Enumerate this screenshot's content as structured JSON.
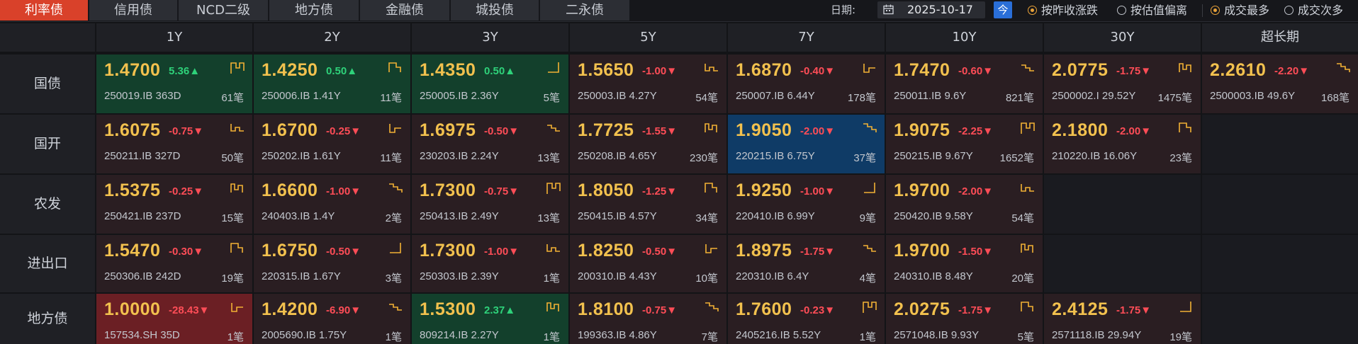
{
  "tabs": [
    {
      "label": "利率债",
      "active": true
    },
    {
      "label": "信用债",
      "active": false
    },
    {
      "label": "NCD二级",
      "active": false
    },
    {
      "label": "地方债",
      "active": false
    },
    {
      "label": "金融债",
      "active": false
    },
    {
      "label": "城投债",
      "active": false
    },
    {
      "label": "二永债",
      "active": false
    }
  ],
  "toolbar": {
    "date_label": "日期:",
    "date_value": "2025-10-17",
    "today_label": "今",
    "sort_options": [
      {
        "label": "按昨收涨跌",
        "selected": true
      },
      {
        "label": "按估值偏离",
        "selected": false
      }
    ],
    "volume_options": [
      {
        "label": "成交最多",
        "selected": true
      },
      {
        "label": "成交次多",
        "selected": false
      }
    ]
  },
  "columns": [
    "1Y",
    "2Y",
    "3Y",
    "5Y",
    "7Y",
    "10Y",
    "30Y",
    "超长期"
  ],
  "rows": [
    {
      "label": "国债",
      "cells": [
        {
          "yield": "1.4700",
          "change": "5.36▲",
          "dir": "pos",
          "code": "250019.IB 363D",
          "count": "61笔",
          "tone": "up",
          "icon": "trend-sparkline-icon"
        },
        {
          "yield": "1.4250",
          "change": "0.50▲",
          "dir": "pos",
          "code": "250006.IB 1.41Y",
          "count": "11笔",
          "tone": "up",
          "icon": "trend-sparkline-icon"
        },
        {
          "yield": "1.4350",
          "change": "0.50▲",
          "dir": "pos",
          "code": "250005.IB 2.36Y",
          "count": "5笔",
          "tone": "up",
          "icon": "trend-sparkline-icon"
        },
        {
          "yield": "1.5650",
          "change": "-1.00▼",
          "dir": "neg",
          "code": "250003.IB 4.27Y",
          "count": "54笔",
          "tone": "dn",
          "icon": "trend-sparkline-icon"
        },
        {
          "yield": "1.6870",
          "change": "-0.40▼",
          "dir": "neg",
          "code": "250007.IB 6.44Y",
          "count": "178笔",
          "tone": "dn",
          "icon": "trend-sparkline-icon"
        },
        {
          "yield": "1.7470",
          "change": "-0.60▼",
          "dir": "neg",
          "code": "250011.IB 9.6Y",
          "count": "821笔",
          "tone": "dn",
          "icon": "trend-sparkline-icon"
        },
        {
          "yield": "2.0775",
          "change": "-1.75▼",
          "dir": "neg",
          "code": "2500002.I 29.52Y",
          "count": "1475笔",
          "tone": "dn",
          "icon": "trend-sparkline-icon"
        },
        {
          "yield": "2.2610",
          "change": "-2.20▼",
          "dir": "neg",
          "code": "2500003.IB 49.6Y",
          "count": "168笔",
          "tone": "dn",
          "icon": "trend-sparkline-icon"
        }
      ]
    },
    {
      "label": "国开",
      "cells": [
        {
          "yield": "1.6075",
          "change": "-0.75▼",
          "dir": "neg",
          "code": "250211.IB 327D",
          "count": "50笔",
          "tone": "dn",
          "icon": "trend-sparkline-icon"
        },
        {
          "yield": "1.6700",
          "change": "-0.25▼",
          "dir": "neg",
          "code": "250202.IB 1.61Y",
          "count": "11笔",
          "tone": "dn",
          "icon": "trend-sparkline-icon"
        },
        {
          "yield": "1.6975",
          "change": "-0.50▼",
          "dir": "neg",
          "code": "230203.IB 2.24Y",
          "count": "13笔",
          "tone": "dn",
          "icon": "trend-sparkline-icon"
        },
        {
          "yield": "1.7725",
          "change": "-1.55▼",
          "dir": "neg",
          "code": "250208.IB 4.65Y",
          "count": "230笔",
          "tone": "dn",
          "icon": "trend-sparkline-icon"
        },
        {
          "yield": "1.9050",
          "change": "-2.00▼",
          "dir": "neg",
          "code": "220215.IB 6.75Y",
          "count": "37笔",
          "tone": "blue",
          "icon": "trend-sparkline-icon"
        },
        {
          "yield": "1.9075",
          "change": "-2.25▼",
          "dir": "neg",
          "code": "250215.IB 9.67Y",
          "count": "1652笔",
          "tone": "dn",
          "icon": "trend-sparkline-icon"
        },
        {
          "yield": "2.1800",
          "change": "-2.00▼",
          "dir": "neg",
          "code": "210220.IB 16.06Y",
          "count": "23笔",
          "tone": "dn",
          "icon": "trend-sparkline-icon"
        },
        null
      ]
    },
    {
      "label": "农发",
      "cells": [
        {
          "yield": "1.5375",
          "change": "-0.25▼",
          "dir": "neg",
          "code": "250421.IB 237D",
          "count": "15笔",
          "tone": "dn",
          "icon": "trend-sparkline-icon"
        },
        {
          "yield": "1.6600",
          "change": "-1.00▼",
          "dir": "neg",
          "code": "240403.IB 1.4Y",
          "count": "2笔",
          "tone": "dn",
          "icon": "trend-sparkline-icon"
        },
        {
          "yield": "1.7300",
          "change": "-0.75▼",
          "dir": "neg",
          "code": "250413.IB 2.49Y",
          "count": "13笔",
          "tone": "dn",
          "icon": "trend-sparkline-icon"
        },
        {
          "yield": "1.8050",
          "change": "-1.25▼",
          "dir": "neg",
          "code": "250415.IB 4.57Y",
          "count": "34笔",
          "tone": "dn",
          "icon": "trend-sparkline-icon"
        },
        {
          "yield": "1.9250",
          "change": "-1.00▼",
          "dir": "neg",
          "code": "220410.IB 6.99Y",
          "count": "9笔",
          "tone": "dn",
          "icon": "trend-sparkline-icon"
        },
        {
          "yield": "1.9700",
          "change": "-2.00▼",
          "dir": "neg",
          "code": "250420.IB 9.58Y",
          "count": "54笔",
          "tone": "dn",
          "icon": "trend-sparkline-icon"
        },
        null,
        null
      ]
    },
    {
      "label": "进出口",
      "cells": [
        {
          "yield": "1.5470",
          "change": "-0.30▼",
          "dir": "neg",
          "code": "250306.IB 242D",
          "count": "19笔",
          "tone": "dn",
          "icon": "trend-sparkline-icon"
        },
        {
          "yield": "1.6750",
          "change": "-0.50▼",
          "dir": "neg",
          "code": "220315.IB 1.67Y",
          "count": "3笔",
          "tone": "dn",
          "icon": "trend-sparkline-icon"
        },
        {
          "yield": "1.7300",
          "change": "-1.00▼",
          "dir": "neg",
          "code": "250303.IB 2.39Y",
          "count": "1笔",
          "tone": "dn",
          "icon": "trend-sparkline-icon"
        },
        {
          "yield": "1.8250",
          "change": "-0.50▼",
          "dir": "neg",
          "code": "200310.IB 4.43Y",
          "count": "10笔",
          "tone": "dn",
          "icon": "trend-sparkline-icon"
        },
        {
          "yield": "1.8975",
          "change": "-1.75▼",
          "dir": "neg",
          "code": "220310.IB 6.4Y",
          "count": "4笔",
          "tone": "dn",
          "icon": "trend-sparkline-icon"
        },
        {
          "yield": "1.9700",
          "change": "-1.50▼",
          "dir": "neg",
          "code": "240310.IB 8.48Y",
          "count": "20笔",
          "tone": "dn",
          "icon": "trend-sparkline-icon"
        },
        null,
        null
      ]
    },
    {
      "label": "地方债",
      "cells": [
        {
          "yield": "1.0000",
          "change": "-28.43▼",
          "dir": "neg",
          "code": "157534.SH 35D",
          "count": "1笔",
          "tone": "deep-dn",
          "icon": "trend-sparkline-icon"
        },
        {
          "yield": "1.4200",
          "change": "-6.90▼",
          "dir": "neg",
          "code": "2005690.IB 1.75Y",
          "count": "1笔",
          "tone": "dn",
          "icon": "trend-sparkline-icon"
        },
        {
          "yield": "1.5300",
          "change": "2.37▲",
          "dir": "pos",
          "code": "809214.IB 2.27Y",
          "count": "1笔",
          "tone": "up",
          "icon": "trend-sparkline-icon"
        },
        {
          "yield": "1.8100",
          "change": "-0.75▼",
          "dir": "neg",
          "code": "199363.IB 4.86Y",
          "count": "7笔",
          "tone": "dn",
          "icon": "trend-sparkline-icon"
        },
        {
          "yield": "1.7600",
          "change": "-0.23▼",
          "dir": "neg",
          "code": "2405216.IB 5.52Y",
          "count": "1笔",
          "tone": "dn",
          "icon": "trend-sparkline-icon"
        },
        {
          "yield": "2.0275",
          "change": "-1.75▼",
          "dir": "neg",
          "code": "2571048.IB 9.93Y",
          "count": "5笔",
          "tone": "dn",
          "icon": "trend-sparkline-icon"
        },
        {
          "yield": "2.4125",
          "change": "-1.75▼",
          "dir": "neg",
          "code": "2571118.IB 29.94Y",
          "count": "19笔",
          "tone": "dn",
          "icon": "trend-sparkline-icon"
        },
        null
      ]
    }
  ]
}
